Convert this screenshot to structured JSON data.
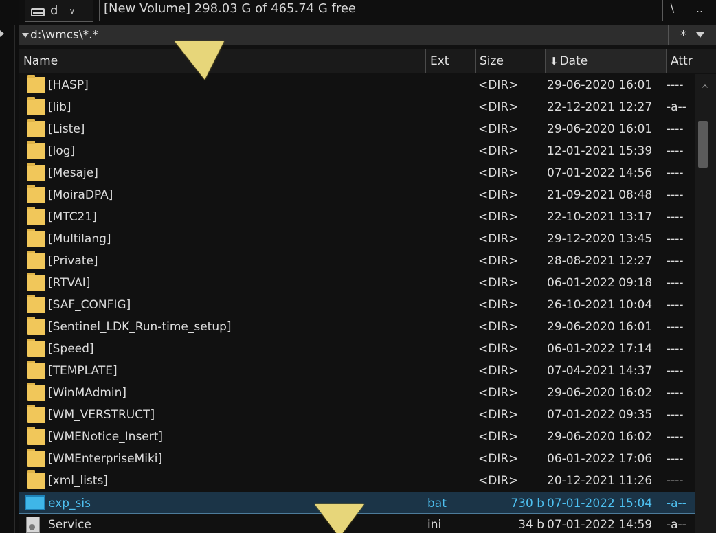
{
  "drive_bar": {
    "drive_letter": "d",
    "drive_chevron": "∨",
    "info": "[New Volume]  298.03 G of 465.74 G free",
    "root_button": "\\",
    "up_button": ".."
  },
  "path_bar": {
    "path": "d:\\wmcs\\*.*",
    "filter_star": "*"
  },
  "columns": {
    "name": "Name",
    "ext": "Ext",
    "size": "Size",
    "date": "Date",
    "date_sort_icon": "arrow-down-icon",
    "attr": "Attr"
  },
  "rows": [
    {
      "name": "[HASP]",
      "ext": "",
      "size": "<DIR>",
      "date": "29-06-2020 16:01",
      "attr": "----"
    },
    {
      "name": "[lib]",
      "ext": "",
      "size": "<DIR>",
      "date": "22-12-2021 12:27",
      "attr": "-a--"
    },
    {
      "name": "[Liste]",
      "ext": "",
      "size": "<DIR>",
      "date": "29-06-2020 16:01",
      "attr": "----"
    },
    {
      "name": "[log]",
      "ext": "",
      "size": "<DIR>",
      "date": "12-01-2021 15:39",
      "attr": "----"
    },
    {
      "name": "[Mesaje]",
      "ext": "",
      "size": "<DIR>",
      "date": "07-01-2022 14:56",
      "attr": "----"
    },
    {
      "name": "[MoiraDPA]",
      "ext": "",
      "size": "<DIR>",
      "date": "21-09-2021 08:48",
      "attr": "----"
    },
    {
      "name": "[MTC21]",
      "ext": "",
      "size": "<DIR>",
      "date": "22-10-2021 13:17",
      "attr": "----"
    },
    {
      "name": "[Multilang]",
      "ext": "",
      "size": "<DIR>",
      "date": "29-12-2020 13:45",
      "attr": "----"
    },
    {
      "name": "[Private]",
      "ext": "",
      "size": "<DIR>",
      "date": "28-08-2021 12:27",
      "attr": "----"
    },
    {
      "name": "[RTVAI]",
      "ext": "",
      "size": "<DIR>",
      "date": "06-01-2022 09:18",
      "attr": "----"
    },
    {
      "name": "[SAF_CONFIG]",
      "ext": "",
      "size": "<DIR>",
      "date": "26-10-2021 10:04",
      "attr": "----"
    },
    {
      "name": "[Sentinel_LDK_Run-time_setup]",
      "ext": "",
      "size": "<DIR>",
      "date": "29-06-2020 16:01",
      "attr": "----"
    },
    {
      "name": "[Speed]",
      "ext": "",
      "size": "<DIR>",
      "date": "06-01-2022 17:14",
      "attr": "----"
    },
    {
      "name": "[TEMPLATE]",
      "ext": "",
      "size": "<DIR>",
      "date": "07-04-2021 14:37",
      "attr": "----"
    },
    {
      "name": "[WinMAdmin]",
      "ext": "",
      "size": "<DIR>",
      "date": "29-06-2020 16:02",
      "attr": "----"
    },
    {
      "name": "[WM_VERSTRUCT]",
      "ext": "",
      "size": "<DIR>",
      "date": "07-01-2022 09:35",
      "attr": "----"
    },
    {
      "name": "[WMENotice_Insert]",
      "ext": "",
      "size": "<DIR>",
      "date": "29-06-2020 16:02",
      "attr": "----"
    },
    {
      "name": "[WMEnterpriseMiki]",
      "ext": "",
      "size": "<DIR>",
      "date": "06-01-2022 17:06",
      "attr": "----"
    },
    {
      "name": "[xml_lists]",
      "ext": "",
      "size": "<DIR>",
      "date": "20-12-2021 11:26",
      "attr": "----"
    },
    {
      "name": "exp_sis",
      "ext": "bat",
      "size": "730 b",
      "date": "07-01-2022 15:04",
      "attr": "-a--"
    },
    {
      "name": "Service",
      "ext": "ini",
      "size": "34 b",
      "date": "07-01-2022 14:59",
      "attr": "-a--"
    }
  ],
  "colors": {
    "selected_text": "#4ec0f0",
    "selected_bg": "#1b3447",
    "folder": "#f1c75a"
  }
}
